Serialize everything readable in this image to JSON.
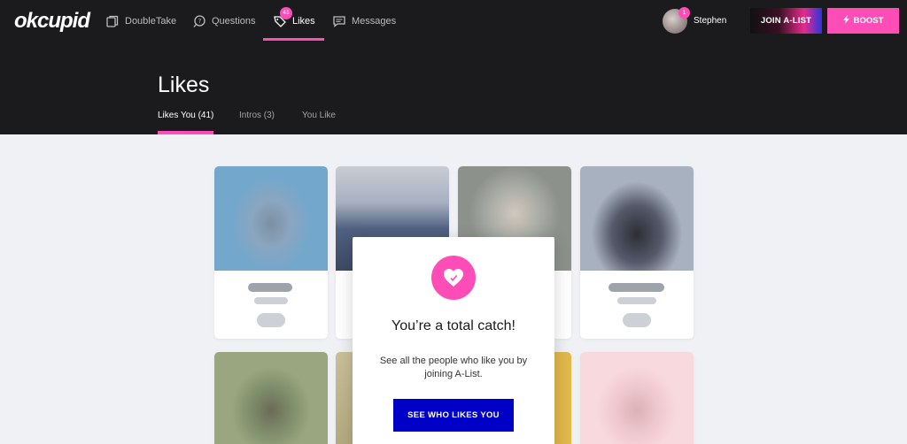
{
  "app": {
    "logo": "okcupid"
  },
  "nav": {
    "items": [
      {
        "label": "DoubleTake",
        "icon": "cards-icon"
      },
      {
        "label": "Questions",
        "icon": "question-icon"
      },
      {
        "label": "Likes",
        "icon": "heart-tag-icon",
        "badge": "41",
        "active": true
      },
      {
        "label": "Messages",
        "icon": "message-icon"
      }
    ]
  },
  "user": {
    "name": "Stephen",
    "badge": "1"
  },
  "header_buttons": {
    "alist": "JOIN A-LIST",
    "boost": "BOOST"
  },
  "page": {
    "title": "Likes",
    "tabs": [
      {
        "label": "Likes You (41)",
        "active": true
      },
      {
        "label": "Intros (3)"
      },
      {
        "label": "You Like"
      }
    ]
  },
  "modal": {
    "title": "You’re a total catch!",
    "text": "See all the people who like you by joining A-List.",
    "button": "SEE WHO LIKES YOU"
  },
  "colors": {
    "accent": "#ff4db8",
    "cta": "#0000c6",
    "nav_bg": "#1b1a1c",
    "page_bg": "#f0f1f5"
  }
}
